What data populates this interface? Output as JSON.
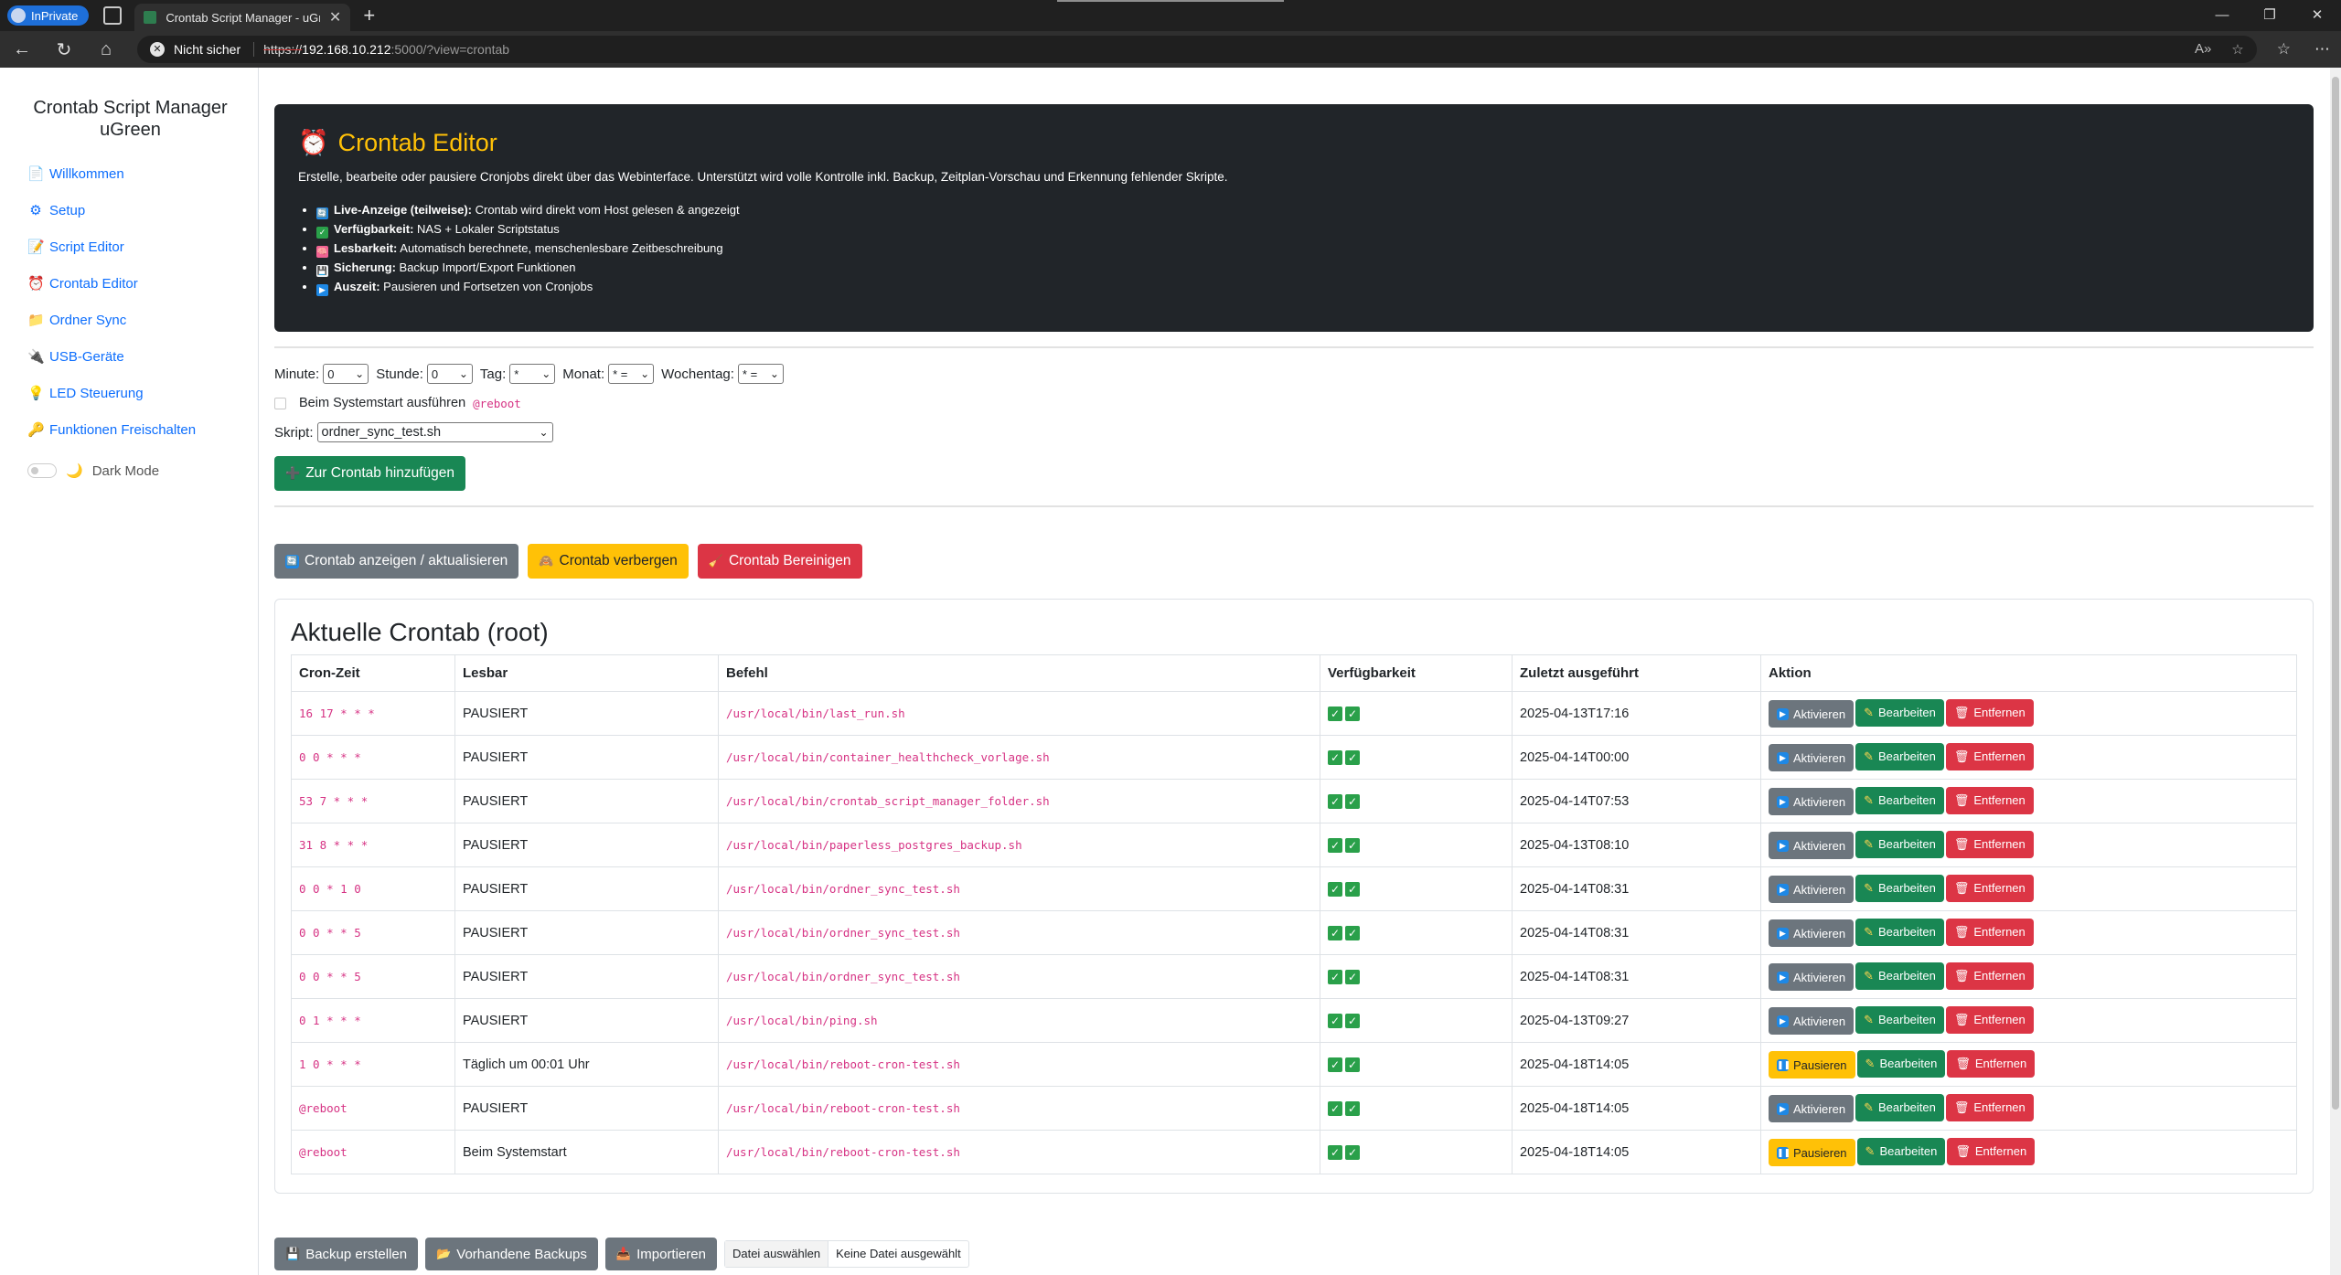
{
  "browser": {
    "inprivate_label": "InPrivate",
    "tab_title": "Crontab Script Manager - uGreen",
    "tab_close": "✕",
    "new_tab": "+",
    "security_label": "Nicht sicher",
    "url_scheme": "https://",
    "url_host": "192.168.10.212",
    "url_path": ":5000/?view=crontab",
    "win_minimize": "—",
    "win_maximize": "❐",
    "win_close": "✕"
  },
  "sidebar": {
    "title": "Crontab Script Manager uGreen",
    "items": [
      {
        "icon": "📄",
        "label": "Willkommen"
      },
      {
        "icon": "⚙",
        "label": "Setup"
      },
      {
        "icon": "📝",
        "label": "Script Editor"
      },
      {
        "icon": "⏰",
        "label": "Crontab Editor"
      },
      {
        "icon": "📁",
        "label": "Ordner Sync"
      },
      {
        "icon": "🔌",
        "label": "USB-Geräte"
      },
      {
        "icon": "💡",
        "label": "LED Steuerung"
      },
      {
        "icon": "🔑",
        "label": "Funktionen Freischalten"
      }
    ],
    "dark_mode_icon": "🌙",
    "dark_mode_label": "Dark Mode"
  },
  "hero": {
    "icon": "⏰",
    "title": "Crontab Editor",
    "description": "Erstelle, bearbeite oder pausiere Cronjobs direkt über das Webinterface. Unterstützt wird volle Kontrolle inkl. Backup, Zeitplan-Vorschau und Erkennung fehlender Skripte.",
    "features": [
      {
        "icon": "🔄",
        "color": "#1e88e5",
        "bold": "Live-Anzeige (teilweise):",
        "text": " Crontab wird direkt vom Host gelesen & angezeigt"
      },
      {
        "icon": "✓",
        "color": "#2aa04a",
        "bold": "Verfügbarkeit:",
        "text": " NAS + Lokaler Scriptstatus"
      },
      {
        "icon": "🧠",
        "color": "#f06292",
        "bold": "Lesbarkeit:",
        "text": " Automatisch berechnete, menschenlesbare Zeitbeschreibung"
      },
      {
        "icon": "💾",
        "color": "#eceff1",
        "bold": "Sicherung:",
        "text": " Backup Import/Export Funktionen"
      },
      {
        "icon": "▶",
        "color": "#1e88e5",
        "bold": "Auszeit:",
        "text": " Pausieren und Fortsetzen von Cronjobs"
      }
    ]
  },
  "form": {
    "minute_label": "Minute:",
    "minute_value": "0",
    "hour_label": "Stunde:",
    "hour_value": "0",
    "day_label": "Tag:",
    "day_value": "*",
    "month_label": "Monat:",
    "month_value": "* =",
    "weekday_label": "Wochentag:",
    "weekday_value": "* =",
    "reboot_label": "Beim Systemstart ausführen",
    "reboot_code": "@reboot",
    "script_label": "Skript:",
    "script_value": "ordner_sync_test.sh",
    "add_icon": "➕",
    "add_label": "Zur Crontab hinzufügen"
  },
  "actions": {
    "show_icon": "🔄",
    "show_label": "Crontab anzeigen / aktualisieren",
    "hide_icon": "🙈",
    "hide_label": "Crontab verbergen",
    "clean_icon": "🧹",
    "clean_label": "Crontab Bereinigen"
  },
  "crontab": {
    "title": "Aktuelle Crontab (root)",
    "columns": [
      "Cron-Zeit",
      "Lesbar",
      "Befehl",
      "Verfügbarkeit",
      "Zuletzt ausgeführt",
      "Aktion"
    ],
    "rows": [
      {
        "cron": "16 17 * * *",
        "readable": "PAUSIERT",
        "cmd": "/usr/local/bin/last_run.sh",
        "last": "2025-04-13T17:16",
        "toggle": "Aktivieren"
      },
      {
        "cron": "0 0 * * *",
        "readable": "PAUSIERT",
        "cmd": "/usr/local/bin/container_healthcheck_vorlage.sh",
        "last": "2025-04-14T00:00",
        "toggle": "Aktivieren"
      },
      {
        "cron": "53 7 * * *",
        "readable": "PAUSIERT",
        "cmd": "/usr/local/bin/crontab_script_manager_folder.sh",
        "last": "2025-04-14T07:53",
        "toggle": "Aktivieren"
      },
      {
        "cron": "31 8 * * *",
        "readable": "PAUSIERT",
        "cmd": "/usr/local/bin/paperless_postgres_backup.sh",
        "last": "2025-04-13T08:10",
        "toggle": "Aktivieren"
      },
      {
        "cron": "0 0 * 1 0",
        "readable": "PAUSIERT",
        "cmd": "/usr/local/bin/ordner_sync_test.sh",
        "last": "2025-04-14T08:31",
        "toggle": "Aktivieren"
      },
      {
        "cron": "0 0 * * 5",
        "readable": "PAUSIERT",
        "cmd": "/usr/local/bin/ordner_sync_test.sh",
        "last": "2025-04-14T08:31",
        "toggle": "Aktivieren"
      },
      {
        "cron": "0 0 * * 5",
        "readable": "PAUSIERT",
        "cmd": "/usr/local/bin/ordner_sync_test.sh",
        "last": "2025-04-14T08:31",
        "toggle": "Aktivieren"
      },
      {
        "cron": "0 1 * * *",
        "readable": "PAUSIERT",
        "cmd": "/usr/local/bin/ping.sh",
        "last": "2025-04-13T09:27",
        "toggle": "Aktivieren"
      },
      {
        "cron": "1 0 * * *",
        "readable": "Täglich um 00:01 Uhr",
        "cmd": "/usr/local/bin/reboot-cron-test.sh",
        "last": "2025-04-18T14:05",
        "toggle": "Pausieren"
      },
      {
        "cron": "@reboot",
        "readable": "PAUSIERT",
        "cmd": "/usr/local/bin/reboot-cron-test.sh",
        "last": "2025-04-18T14:05",
        "toggle": "Aktivieren"
      },
      {
        "cron": "@reboot",
        "readable": "Beim Systemstart",
        "cmd": "/usr/local/bin/reboot-cron-test.sh",
        "last": "2025-04-18T14:05",
        "toggle": "Pausieren"
      }
    ],
    "edit_label": "Bearbeiten",
    "remove_label": "Entfernen"
  },
  "backup": {
    "create_icon": "💾",
    "create_label": "Backup erstellen",
    "existing_icon": "📂",
    "existing_label": "Vorhandene Backups",
    "import_icon": "📥",
    "import_label": "Importieren",
    "file_button": "Datei auswählen",
    "file_status": "Keine Datei ausgewählt"
  },
  "colors": {
    "accent": "#0d6efd",
    "success": "#198754",
    "warning": "#ffc107",
    "danger": "#dc3545",
    "secondary": "#6c757d",
    "hero_bg": "#212529",
    "code": "#d63384"
  }
}
